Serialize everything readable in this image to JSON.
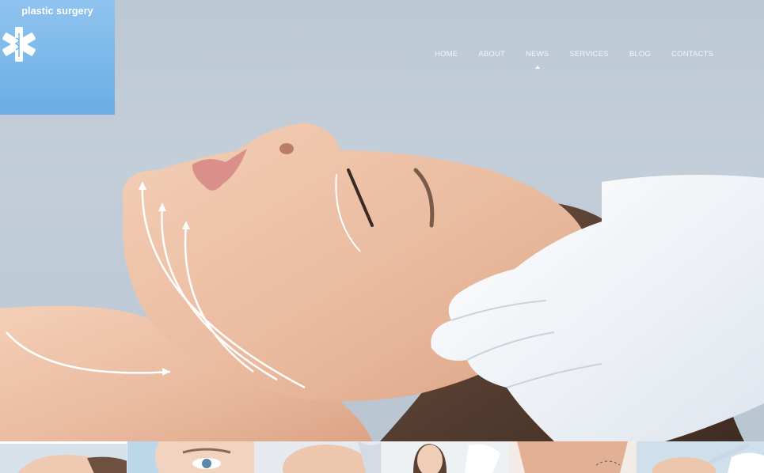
{
  "brand": {
    "name": "plastic surgery",
    "icon": "caduceus-star-icon",
    "color": "#79b7e8"
  },
  "nav": {
    "items": [
      {
        "label": "HOME"
      },
      {
        "label": "ABOUT"
      },
      {
        "label": "NEWS",
        "active": true
      },
      {
        "label": "SERVICES"
      },
      {
        "label": "BLOG"
      },
      {
        "label": "CONTACTS"
      }
    ]
  },
  "hero": {
    "image": "woman-face-lift-photo"
  },
  "thumbnails": [
    {
      "image": "woman-lying-face-thumbnail"
    },
    {
      "image": "eye-closeup-thumbnail"
    },
    {
      "image": "face-treatment-thumbnail"
    },
    {
      "image": "woman-injection-thumbnail"
    },
    {
      "image": "back-skin-thumbnail"
    },
    {
      "image": "syringe-face-thumbnail"
    }
  ]
}
